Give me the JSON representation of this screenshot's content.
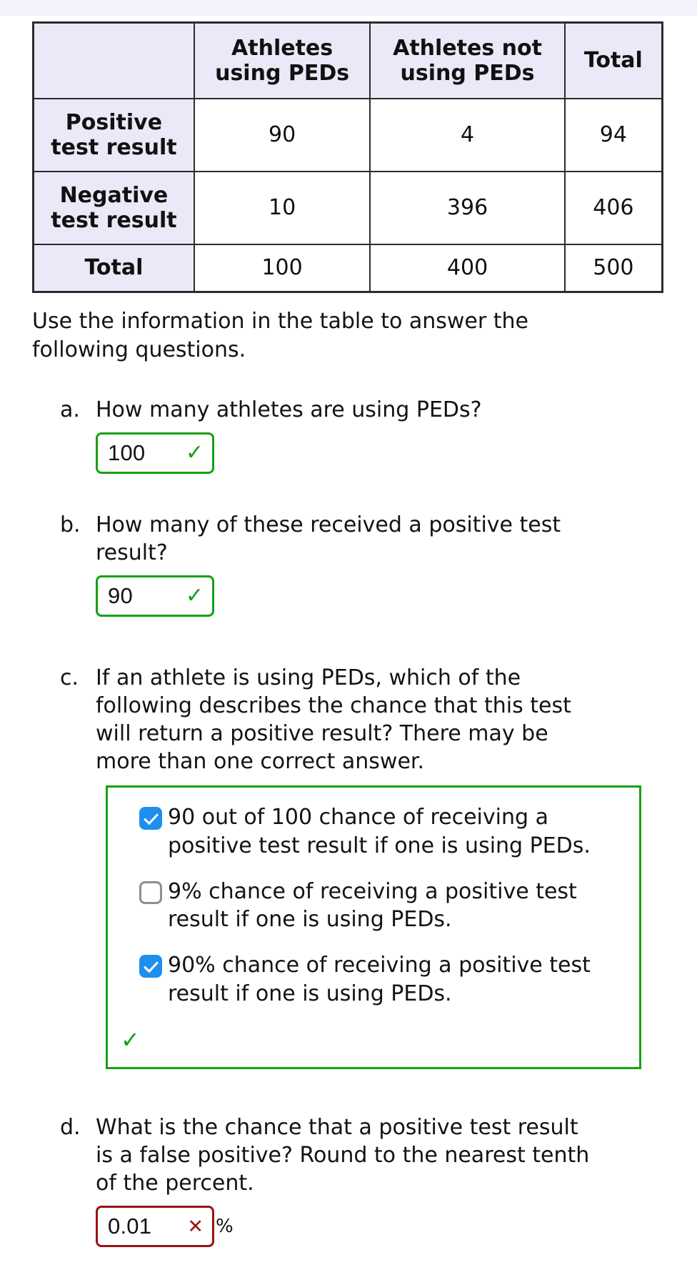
{
  "chart_data": {
    "type": "table",
    "title": "PED testing two-way frequency table",
    "columns": [
      "",
      "Athletes using PEDs",
      "Athletes not using PEDs",
      "Total"
    ],
    "rows": [
      {
        "label": "Positive test result",
        "values": [
          90,
          4,
          94
        ]
      },
      {
        "label": "Negative test result",
        "values": [
          10,
          396,
          406
        ]
      },
      {
        "label": "Total",
        "values": [
          100,
          400,
          500
        ]
      }
    ]
  },
  "table": {
    "corner": "",
    "headers": [
      {
        "line1": "Athletes",
        "line2": "using PEDs"
      },
      {
        "line1": "Athletes not",
        "line2": "using PEDs"
      },
      {
        "line1": "Total",
        "line2": ""
      }
    ],
    "rows": [
      {
        "label_line1": "Positive",
        "label_line2": "test result",
        "cells": [
          "90",
          "4",
          "94"
        ]
      },
      {
        "label_line1": "Negative",
        "label_line2": "test result",
        "cells": [
          "10",
          "396",
          "406"
        ]
      },
      {
        "label_line1": "Total",
        "label_line2": "",
        "cells": [
          "100",
          "400",
          "500"
        ]
      }
    ]
  },
  "prompt": " Use the information in the table to answer the following questions.",
  "questions": {
    "a": {
      "marker": "a.",
      "text": "How many athletes are using PEDs?",
      "answer_value": "100",
      "status": "correct",
      "status_icon": "check-icon"
    },
    "b": {
      "marker": "b.",
      "text": "How many of these received a positive test result?",
      "answer_value": "90",
      "status": "correct",
      "status_icon": "check-icon"
    },
    "c": {
      "marker": "c.",
      "text": "If an athlete is using PEDs, which of the following describes the chance that this test will return a positive result? There may be more than one correct answer.",
      "options": [
        {
          "label": "90 out of 100 chance of receiving a positive test result if one is using PEDs.",
          "checked": true
        },
        {
          "label": "9% chance of receiving a positive test result if one is using PEDs.",
          "checked": false
        },
        {
          "label": "90% chance of receiving a positive test result if one is using PEDs.",
          "checked": true
        }
      ],
      "status": "correct",
      "status_icon": "check-icon"
    },
    "d": {
      "marker": "d.",
      "text": "What is the chance that a positive test result is a false positive? Round to the nearest tenth of the percent.",
      "answer_value": "0.01",
      "suffix": "%",
      "status": "incorrect",
      "status_icon": "cross-icon"
    }
  },
  "icons": {
    "check": "✓",
    "cross": "✕"
  },
  "colors": {
    "correct": "#16a111",
    "incorrect": "#9b1212",
    "checkbox_checked": "#1e8fee",
    "header_cell": "#e9e9f8",
    "top_strip": "#f2f2fb"
  }
}
